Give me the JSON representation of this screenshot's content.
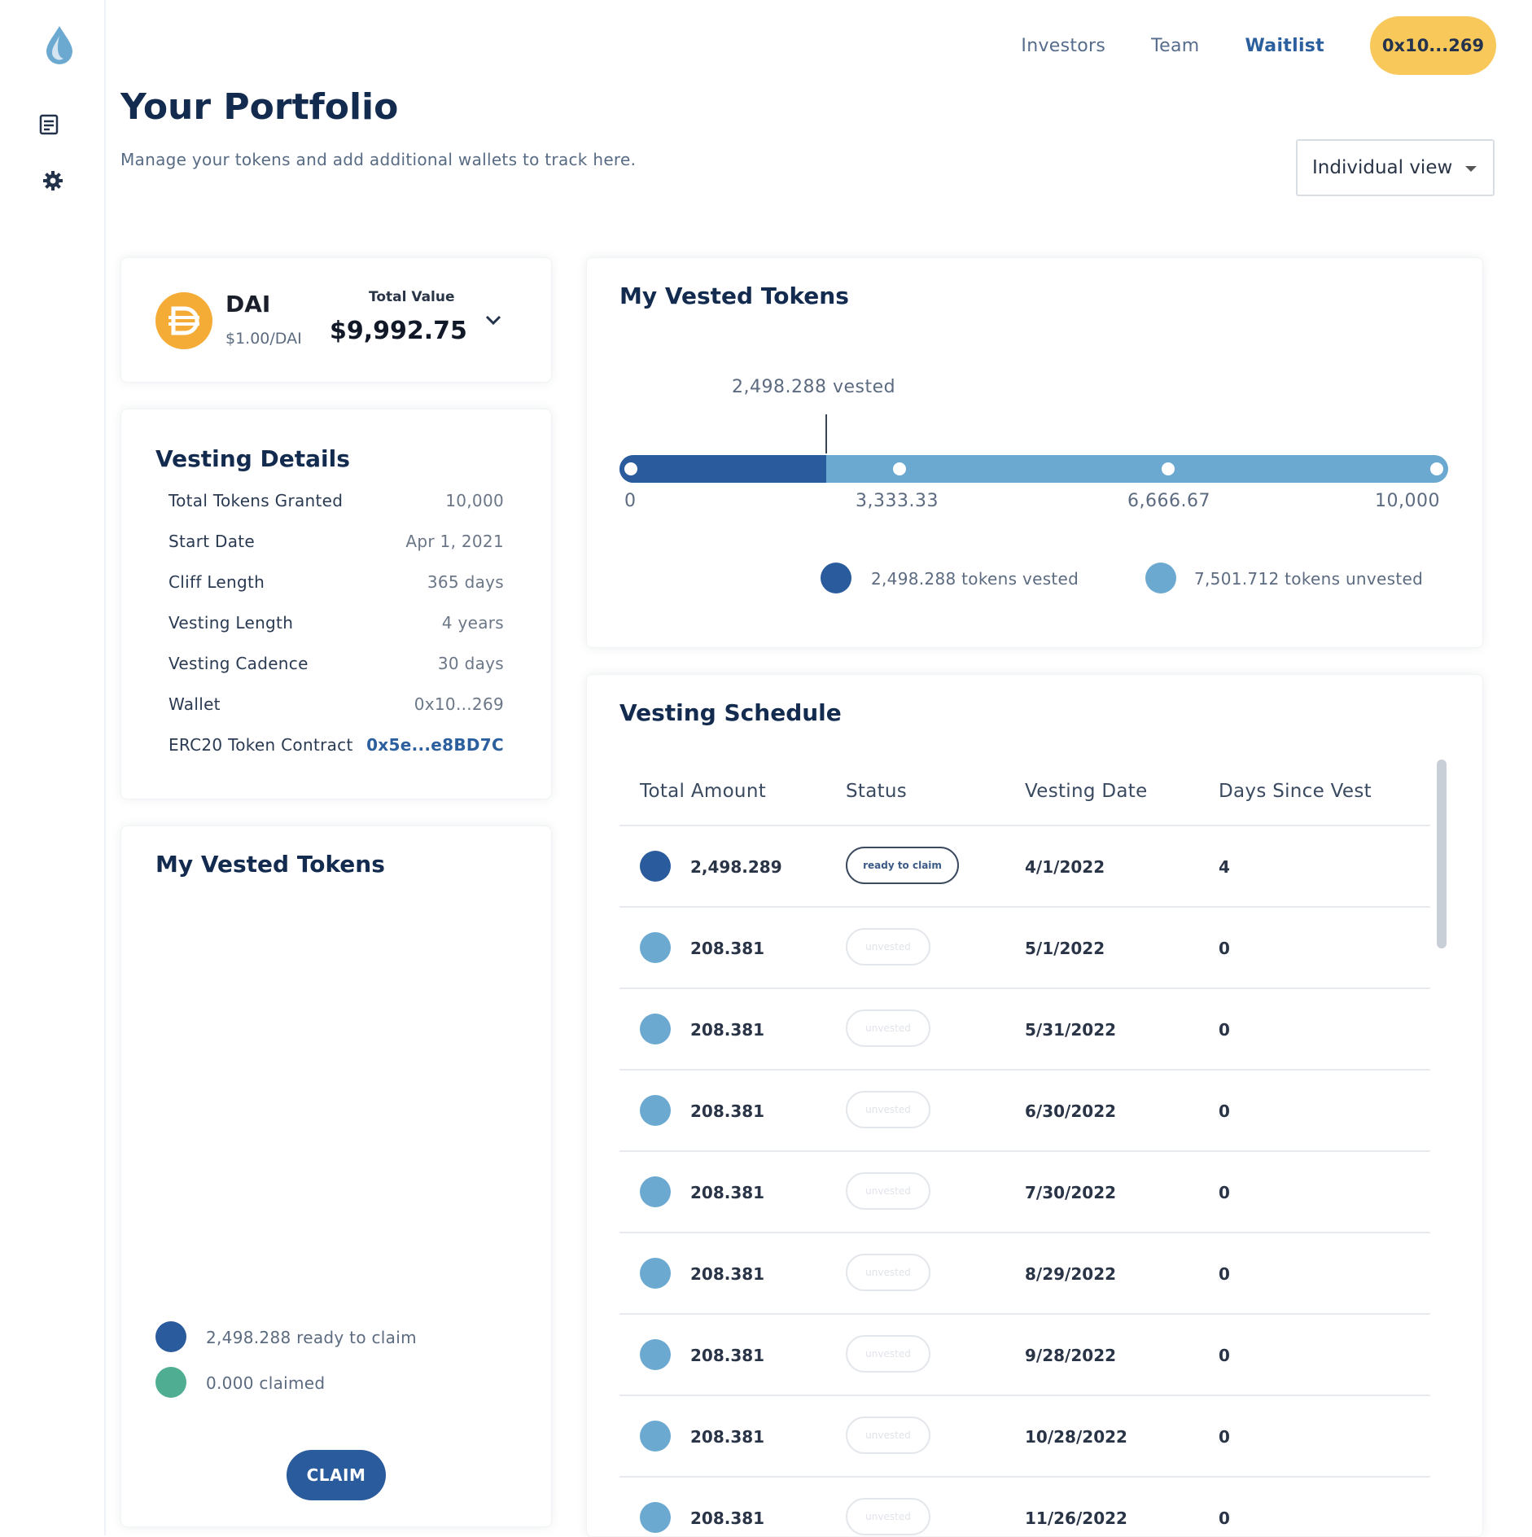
{
  "nav": {
    "links": [
      "Investors",
      "Team",
      "Waitlist"
    ],
    "active": "Waitlist",
    "wallet": "0x10...269"
  },
  "page": {
    "title": "Your Portfolio",
    "subtitle": "Manage your tokens and add additional wallets to track here.",
    "view_select": "Individual view"
  },
  "token": {
    "name": "DAI",
    "price": "$1.00/DAI",
    "total_value_label": "Total Value",
    "total_value": "$9,992.75"
  },
  "vesting_details": {
    "title": "Vesting Details",
    "rows": [
      {
        "label": "Total Tokens Granted",
        "value": "10,000"
      },
      {
        "label": "Start Date",
        "value": "Apr 1, 2021"
      },
      {
        "label": "Cliff Length",
        "value": "365 days"
      },
      {
        "label": "Vesting Length",
        "value": "4 years"
      },
      {
        "label": "Vesting Cadence",
        "value": "30 days"
      },
      {
        "label": "Wallet",
        "value": "0x10...269"
      },
      {
        "label": "ERC20 Token Contract",
        "value": "0x5e...e8BD7C"
      }
    ]
  },
  "claim_panel": {
    "title": "My Vested Tokens",
    "legend": [
      "2,498.288 ready to claim",
      "0.000 claimed"
    ],
    "claim_button": "CLAIM"
  },
  "vested_chart": {
    "title": "My Vested Tokens",
    "vested_label": "2,498.288 vested",
    "vested": 2498.288,
    "total": 10000,
    "ticks": [
      "0",
      "3,333.33",
      "6,666.67",
      "10,000"
    ],
    "legend": [
      "2,498.288 tokens vested",
      "7,501.712 tokens unvested"
    ]
  },
  "schedule": {
    "title": "Vesting Schedule",
    "headers": [
      "Total Amount",
      "Status",
      "Vesting Date",
      "Days Since Vest"
    ],
    "rows": [
      {
        "amount": "2,498.289",
        "status": "ready to claim",
        "date": "4/1/2022",
        "days": "4"
      },
      {
        "amount": "208.381",
        "status": "unvested",
        "date": "5/1/2022",
        "days": "0"
      },
      {
        "amount": "208.381",
        "status": "unvested",
        "date": "5/31/2022",
        "days": "0"
      },
      {
        "amount": "208.381",
        "status": "unvested",
        "date": "6/30/2022",
        "days": "0"
      },
      {
        "amount": "208.381",
        "status": "unvested",
        "date": "7/30/2022",
        "days": "0"
      },
      {
        "amount": "208.381",
        "status": "unvested",
        "date": "8/29/2022",
        "days": "0"
      },
      {
        "amount": "208.381",
        "status": "unvested",
        "date": "9/28/2022",
        "days": "0"
      },
      {
        "amount": "208.381",
        "status": "unvested",
        "date": "10/28/2022",
        "days": "0"
      },
      {
        "amount": "208.381",
        "status": "unvested",
        "date": "11/26/2022",
        "days": "0"
      }
    ]
  },
  "colors": {
    "vested": "#2a5b9c",
    "unvested": "#6ba9d1",
    "claimed": "#4fae92",
    "accent": "#f8c85b"
  }
}
